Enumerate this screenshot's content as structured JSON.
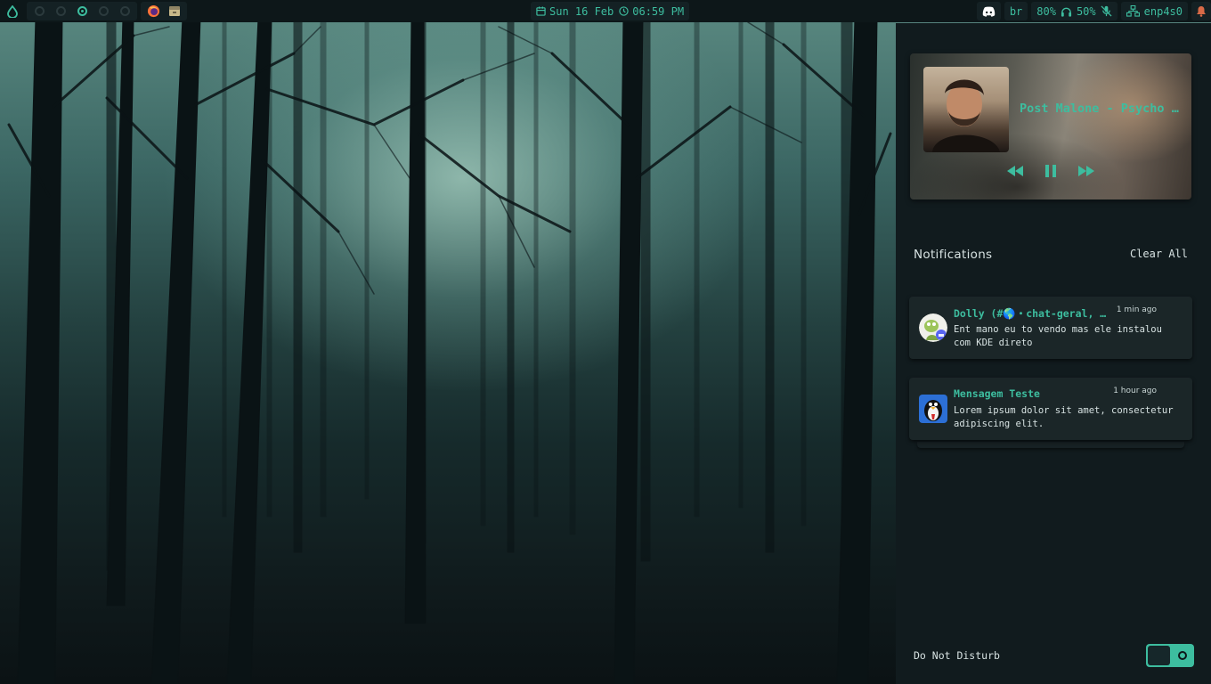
{
  "topbar": {
    "launcher_icon": "droplet-icon",
    "workspaces": [
      {
        "name": "workspace-1",
        "active": false
      },
      {
        "name": "workspace-2",
        "active": false
      },
      {
        "name": "workspace-3",
        "active": true
      },
      {
        "name": "workspace-4",
        "active": false
      },
      {
        "name": "workspace-5",
        "active": false
      }
    ],
    "apps": [
      "firefox-icon",
      "file-manager-icon"
    ],
    "date": "Sun 16 Feb",
    "time": "06:59 PM",
    "right": {
      "discord_icon": "discord-icon",
      "keyboard_layout": "br",
      "volume": "80%",
      "mic": "50%",
      "network": "enp4s0",
      "bell_icon": "bell-icon"
    }
  },
  "media": {
    "title": "Post Malone - Psycho ft. Ty Dolla $ign",
    "controls": [
      "previous-icon",
      "pause-icon",
      "next-icon"
    ]
  },
  "notifications": {
    "header": "Notifications",
    "clear_all": "Clear All",
    "items": [
      {
        "app": "Dolly (#🌎・chat-geral, Linux)",
        "time": "1 min ago",
        "body": "Ent mano eu to vendo mas ele instalou com KDE direto"
      },
      {
        "app": "Mensagem Teste",
        "time": "1 hour ago",
        "body": "Lorem ipsum dolor sit amet, consectetur adipiscing elit."
      }
    ]
  },
  "dnd": {
    "label": "Do Not Disturb",
    "enabled": false
  },
  "colors": {
    "accent": "#3dbd9f",
    "panel_bg": "#111b1e",
    "bar_bg": "#0d1719",
    "card_bg": "#1b2628",
    "warning": "#d86a47"
  }
}
